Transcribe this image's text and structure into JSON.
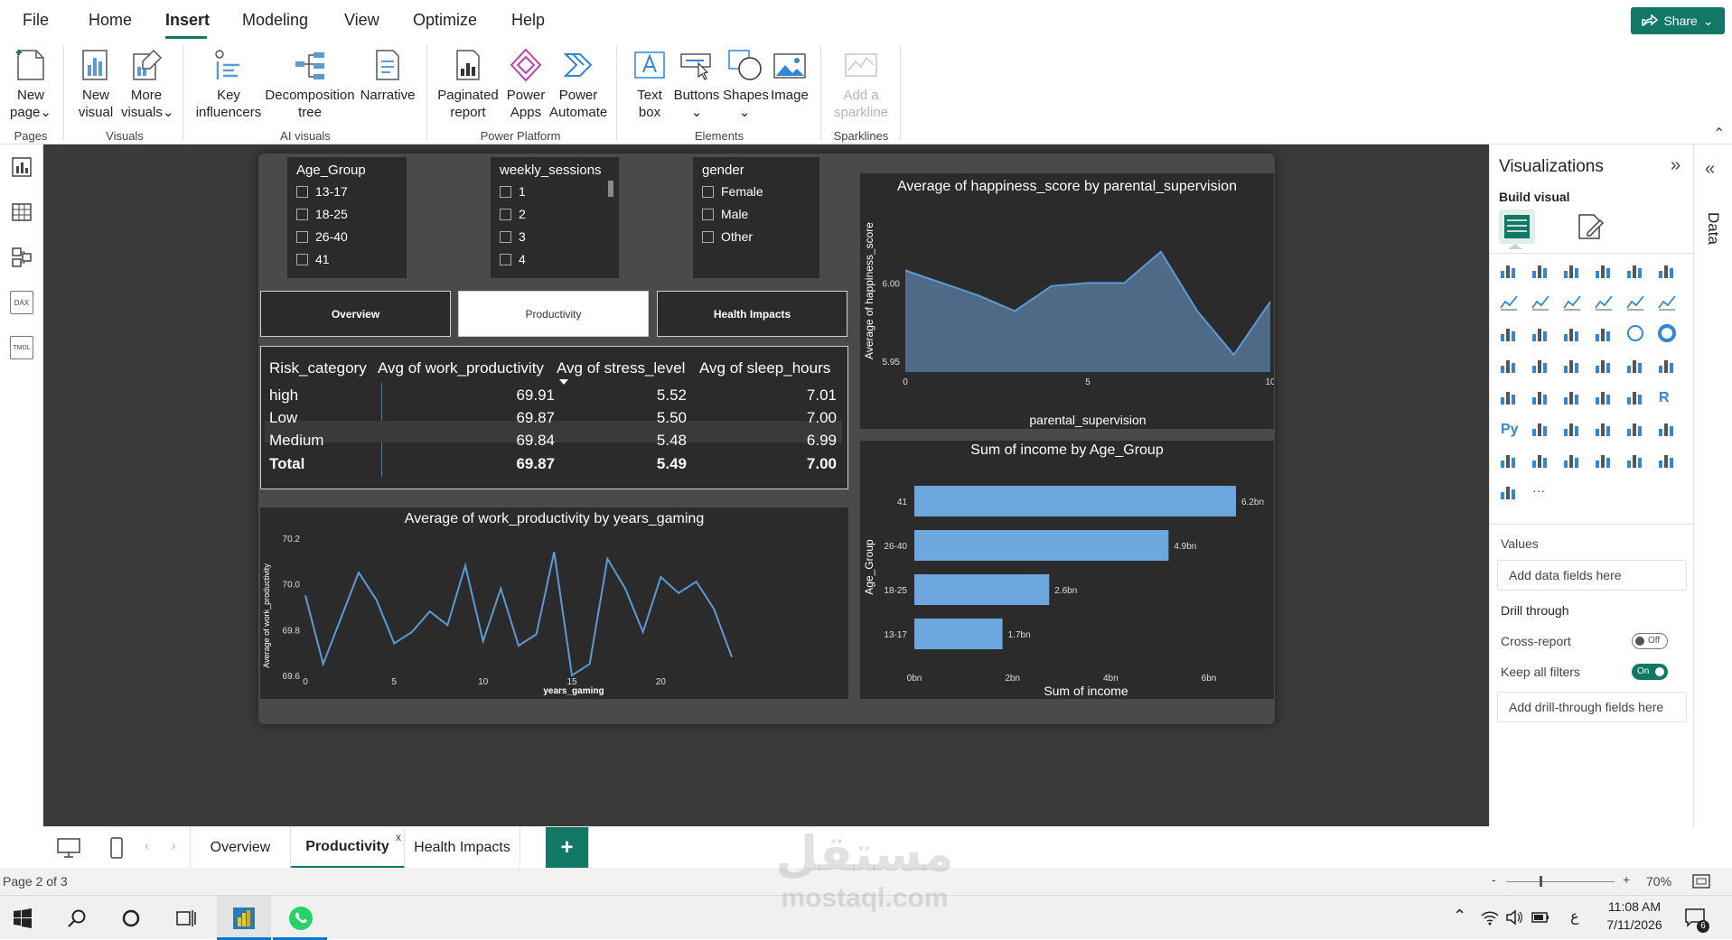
{
  "menu": {
    "items": [
      "File",
      "Home",
      "Insert",
      "Modeling",
      "View",
      "Optimize",
      "Help"
    ],
    "active": "Insert",
    "share_label": "Share"
  },
  "ribbon": {
    "new_page": [
      "New",
      "page"
    ],
    "new_visual": [
      "New",
      "visual"
    ],
    "more_visuals": [
      "More",
      "visuals"
    ],
    "key_influencers": [
      "Key",
      "influencers"
    ],
    "decomposition_tree": [
      "Decomposition",
      "tree"
    ],
    "narrative": "Narrative",
    "paginated_report": [
      "Paginated",
      "report"
    ],
    "power_apps": [
      "Power",
      "Apps"
    ],
    "power_automate": [
      "Power",
      "Automate"
    ],
    "text_box": [
      "Text",
      "box"
    ],
    "buttons": "Buttons",
    "shapes": "Shapes",
    "image": "Image",
    "add_sparkline": [
      "Add a",
      "sparkline"
    ],
    "groups": {
      "pages": "Pages",
      "visuals": "Visuals",
      "ai": "AI visuals",
      "platform": "Power Platform",
      "elements": "Elements",
      "sparklines": "Sparklines"
    }
  },
  "leftrail": {
    "icons": [
      "report-view-icon",
      "table-view-icon",
      "model-view-icon",
      "dax-query-icon",
      "tmdl-view-icon"
    ],
    "dax": "DAX",
    "tmdl": "TMDL"
  },
  "slicers": {
    "age_group": {
      "title": "Age_Group",
      "items": [
        "13-17",
        "18-25",
        "26-40",
        "41"
      ]
    },
    "weekly_sessions": {
      "title": "weekly_sessions",
      "items": [
        "1",
        "2",
        "3",
        "4"
      ]
    },
    "gender": {
      "title": "gender",
      "items": [
        "Female",
        "Male",
        "Other"
      ]
    }
  },
  "nav_buttons": {
    "overview": "Overview",
    "productivity": "Productivity",
    "health": "Health Impacts"
  },
  "matrix": {
    "headers": [
      "Risk_category",
      "Avg of work_productivity",
      "Avg of stress_level",
      "Avg of sleep_hours"
    ],
    "rows": [
      {
        "cat": "high",
        "prod": "69.91",
        "stress": "5.52",
        "sleep": "7.01"
      },
      {
        "cat": "Low",
        "prod": "69.87",
        "stress": "5.50",
        "sleep": "7.00"
      },
      {
        "cat": "Medium",
        "prod": "69.84",
        "stress": "5.48",
        "sleep": "6.99"
      }
    ],
    "total": {
      "cat": "Total",
      "prod": "69.87",
      "stress": "5.49",
      "sleep": "7.00"
    }
  },
  "chart_data": [
    {
      "type": "area",
      "title": "Average of happiness_score by parental_supervision",
      "xlabel": "parental_supervision",
      "ylabel": "Average of happiness_score",
      "x": [
        0,
        1,
        2,
        3,
        4,
        5,
        6,
        7,
        8,
        9,
        10
      ],
      "y": [
        6.008,
        6.0,
        5.992,
        5.982,
        5.998,
        6.0,
        6.0,
        6.02,
        5.982,
        5.954,
        5.988
      ],
      "xlim": [
        0,
        10
      ],
      "ylim": [
        5.943,
        6.047
      ],
      "xticks": [
        "0",
        "5",
        "10"
      ],
      "yticks": [
        "5.95",
        "6.00"
      ],
      "color": "#5b9bd5",
      "fill": "#4e6a86"
    },
    {
      "type": "bar",
      "orientation": "horizontal",
      "title": "Sum of income by Age_Group",
      "xlabel": "Sum of income",
      "ylabel": "Age_Group",
      "categories": [
        "41",
        "26-40",
        "18-25",
        "13-17"
      ],
      "values": [
        6.2,
        4.9,
        2.6,
        1.7
      ],
      "labels": [
        "6.2bn",
        "4.9bn",
        "2.6bn",
        "1.7bn"
      ],
      "xlim": [
        0,
        6.2
      ],
      "xticks": [
        "0bn",
        "2bn",
        "4bn",
        "6bn"
      ],
      "color": "#6ca8de"
    },
    {
      "type": "line",
      "title": "Average of work_productivity by years_gaming",
      "xlabel": "years_gaming",
      "ylabel": "Average of work_productivity",
      "x": [
        0,
        1,
        2,
        3,
        4,
        5,
        6,
        7,
        8,
        9,
        10,
        11,
        12,
        13,
        14,
        15,
        16,
        17,
        18,
        19,
        20,
        21,
        22,
        23,
        24
      ],
      "y": [
        69.95,
        69.65,
        69.85,
        70.05,
        69.93,
        69.74,
        69.79,
        69.88,
        69.82,
        70.08,
        69.75,
        69.98,
        69.73,
        69.78,
        70.14,
        69.6,
        69.65,
        70.11,
        69.98,
        69.79,
        70.03,
        69.96,
        70.01,
        69.89,
        69.68
      ],
      "xlim": [
        0,
        24
      ],
      "ylim": [
        69.6,
        70.2
      ],
      "xticks": [
        "0",
        "5",
        "10",
        "15",
        "20"
      ],
      "yticks": [
        "69.6",
        "69.8",
        "70.0",
        "70.2"
      ],
      "color": "#5b9bd5"
    }
  ],
  "vizpane": {
    "title": "Visualizations",
    "build_visual": "Build visual",
    "values_label": "Values",
    "values_placeholder": "Add data fields here",
    "drill_through": "Drill through",
    "cross_report": "Cross-report",
    "cross_report_state": "Off",
    "keep_filters": "Keep all filters",
    "keep_filters_state": "On",
    "drill_placeholder": "Add drill-through fields here",
    "data_tab": "Data",
    "more": "···"
  },
  "tabs": {
    "items": [
      "Overview",
      "Productivity",
      "Health Impacts"
    ],
    "active": "Productivity",
    "close": "x",
    "add": "+"
  },
  "status": {
    "page": "Page 2 of 3",
    "zoom": "70%",
    "minus": "-",
    "plus": "+"
  },
  "taskbar": {
    "time": "11:08 AM",
    "date": "7/11/2026",
    "lang": "ع",
    "notif": "6"
  },
  "watermark": {
    "arabic": "مستقل",
    "latin": "mostaql.com"
  }
}
